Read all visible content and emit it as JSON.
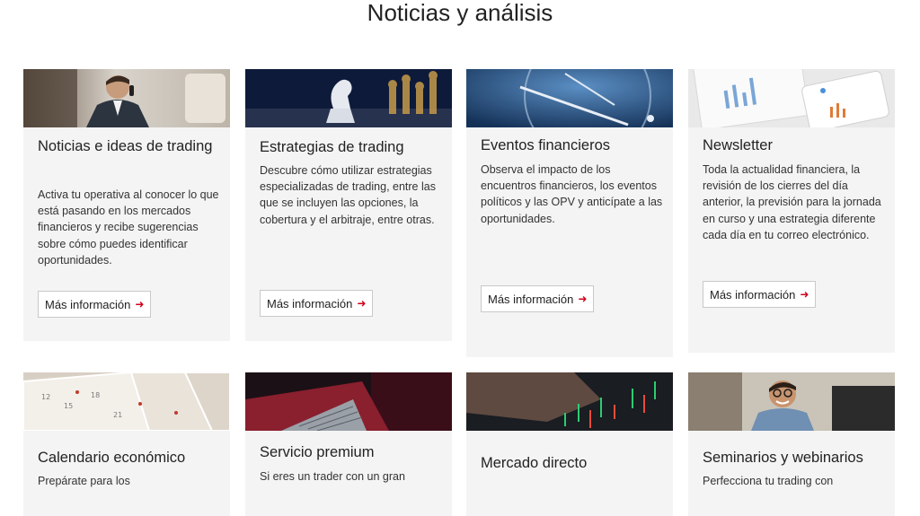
{
  "section": {
    "title": "Noticias y análisis"
  },
  "cards": [
    {
      "title": "Noticias e ideas de trading",
      "description": "Activa tu operativa al conocer lo que está pasando en los mercados financieros y recibe sugerencias sobre cómo puedes identificar oportunidades.",
      "button": "Más información"
    },
    {
      "title": "Estrategias de trading",
      "description": "Descubre cómo utilizar estrategias especializadas de trading, entre las que se incluyen las opciones, la cobertura y el arbitraje, entre otras.",
      "button": "Más información"
    },
    {
      "title": "Eventos financieros",
      "description": "Observa el impacto de los encuentros financieros, los eventos políticos y las OPV y anticípate a las oportunidades.",
      "button": "Más información"
    },
    {
      "title": "Newsletter",
      "description": "Toda la actualidad financiera, la revisión de los cierres del día anterior, la previsión para la jornada en curso y una estrategia diferente cada día en tu correo electrónico.",
      "button": "Más información"
    },
    {
      "title": "Calendario económico",
      "description": "Prepárate para los"
    },
    {
      "title": "Servicio premium",
      "description": "Si eres un trader con un gran"
    },
    {
      "title": "Mercado directo"
    },
    {
      "title": "Seminarios y webinarios",
      "description": "Perfecciona tu trading con"
    }
  ],
  "icons": {
    "arrow": "arrow-right-icon"
  },
  "colors": {
    "accent": "#d0021b",
    "card_bg": "#f4f4f4"
  }
}
